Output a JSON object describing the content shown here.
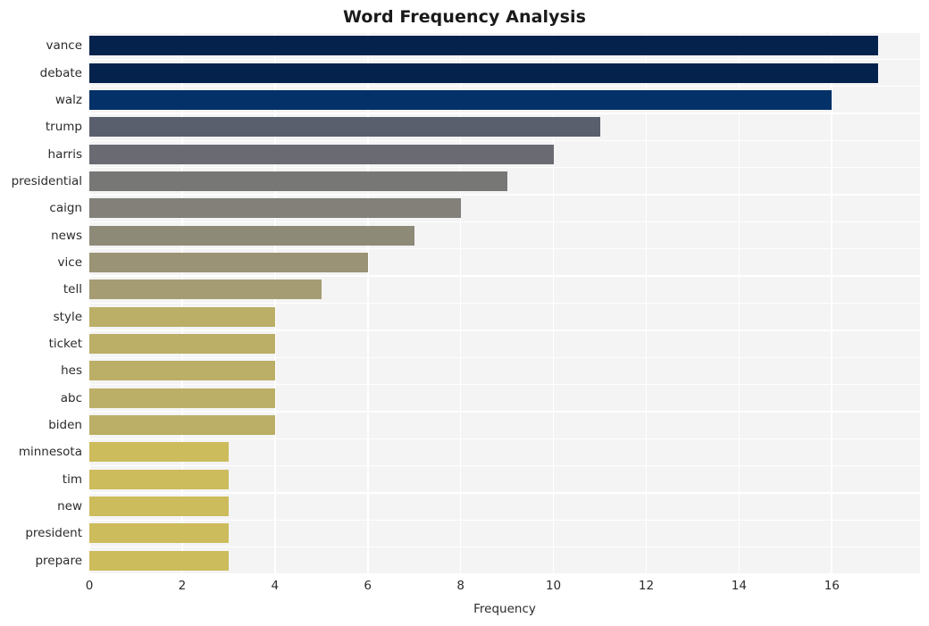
{
  "chart_data": {
    "type": "bar",
    "orientation": "horizontal",
    "title": "Word Frequency Analysis",
    "xlabel": "Frequency",
    "ylabel": "",
    "categories": [
      "vance",
      "debate",
      "walz",
      "trump",
      "harris",
      "presidential",
      "caign",
      "news",
      "vice",
      "tell",
      "style",
      "ticket",
      "hes",
      "abc",
      "biden",
      "minnesota",
      "tim",
      "new",
      "president",
      "prepare"
    ],
    "values": [
      17,
      17,
      16,
      11,
      10,
      9,
      8,
      7,
      6,
      5,
      4,
      4,
      4,
      4,
      4,
      3,
      3,
      3,
      3,
      3
    ],
    "xlim": [
      0,
      17.9
    ],
    "xticks": [
      0,
      2,
      4,
      6,
      8,
      10,
      12,
      14,
      16
    ],
    "xtick_labels": [
      "0",
      "2",
      "4",
      "6",
      "8",
      "10",
      "12",
      "14",
      "16"
    ],
    "grid": true,
    "grid_color": "#ffffff",
    "plot_background": "#f4f4f5",
    "figure_background": "#ffffff",
    "legend": null,
    "bar_colors": [
      "#05224c",
      "#05224c",
      "#043168",
      "#5a5f6e",
      "#696a72",
      "#777776",
      "#83807a",
      "#8e8a78",
      "#9a9375",
      "#a59c73",
      "#bbae67",
      "#bbae67",
      "#bbae67",
      "#bbae67",
      "#bbae67",
      "#ccbc5c",
      "#ccbc5c",
      "#ccbc5c",
      "#ccbc5c",
      "#ccbc5c"
    ]
  },
  "axes": {
    "x_label": "Frequency"
  }
}
